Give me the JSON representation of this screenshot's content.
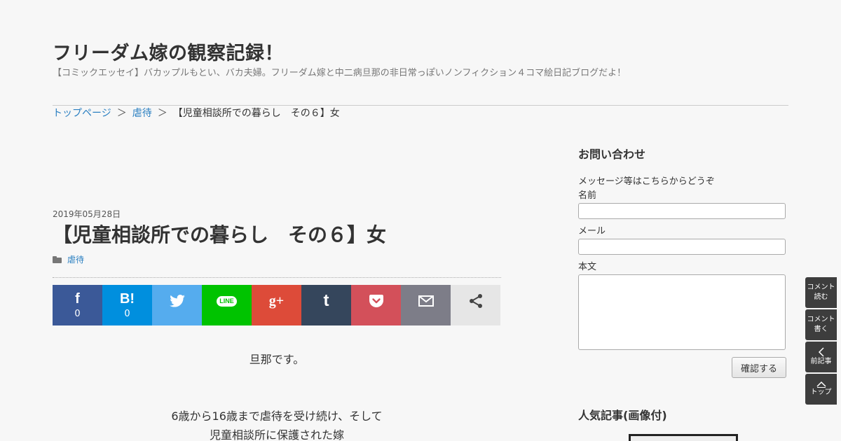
{
  "header": {
    "site_title": "フリーダム嫁の観察記録！",
    "site_description": "【コミックエッセイ】バカップルもとい、バカ夫婦。フリーダム嫁と中二病旦那の非日常っぽいノンフィクション４コマ絵日記ブログだよ！"
  },
  "breadcrumb": {
    "items": [
      "トップページ",
      "虐待",
      "【児童相談所での暮らし　その６】女"
    ],
    "separator": "＞"
  },
  "post": {
    "date": "2019年05月28日",
    "title": "【児童相談所での暮らし　その６】女",
    "category": "虐待",
    "body": [
      "旦那です。",
      "6歳から16歳まで虐待を受け続け、そして",
      "児童相談所に保護された嫁"
    ]
  },
  "share": [
    {
      "name": "facebook",
      "glyph": "f",
      "count": "0",
      "color": "#3b5998"
    },
    {
      "name": "hatena",
      "glyph": "B!",
      "count": "0",
      "color": "#008fde"
    },
    {
      "name": "twitter",
      "glyph": "🐦",
      "count": "",
      "color": "#55acee"
    },
    {
      "name": "line",
      "glyph": "LINE",
      "count": "",
      "color": "#00c300"
    },
    {
      "name": "google-plus",
      "glyph": "g+",
      "count": "",
      "color": "#dd4b39"
    },
    {
      "name": "tumblr",
      "glyph": "t",
      "count": "",
      "color": "#35465c"
    },
    {
      "name": "pocket",
      "glyph": "♡",
      "count": "",
      "color": "#d3505a"
    },
    {
      "name": "mail",
      "glyph": "✉",
      "count": "",
      "color": "#7d7d88"
    },
    {
      "name": "share",
      "glyph": "⋖",
      "count": "",
      "color": "#e6e6e6"
    }
  ],
  "sidebar": {
    "contact_title": "お問い合わせ",
    "contact_intro": "メッセージ等はこちらからどうぞ",
    "name_label": "名前",
    "email_label": "メール",
    "body_label": "本文",
    "confirm_label": "確認する",
    "popular_title": "人気記事(画像付)"
  },
  "float_nav": [
    {
      "line1": "コメント",
      "line2": "読む",
      "icon": ""
    },
    {
      "line1": "コメント",
      "line2": "書く",
      "icon": ""
    },
    {
      "line1": "前記事",
      "line2": "",
      "icon": "chevron-left-icon"
    },
    {
      "line1": "トップ",
      "line2": "",
      "icon": "chevron-up-icon"
    }
  ]
}
